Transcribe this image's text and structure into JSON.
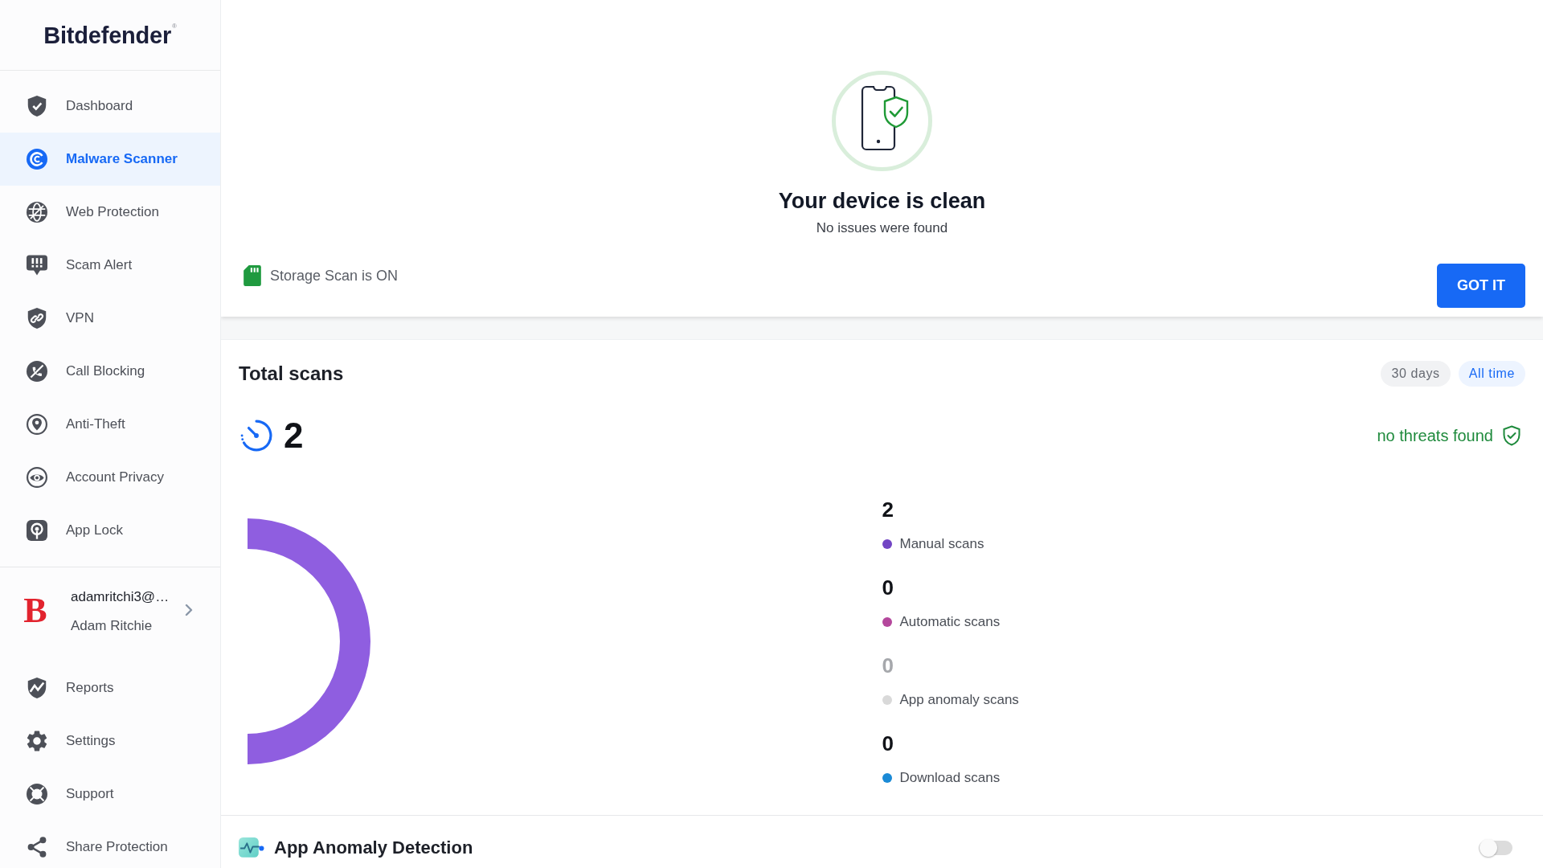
{
  "sidebar": {
    "brand": {
      "name": "Bitdefender",
      "mark": "®"
    },
    "items": [
      {
        "label": "Dashboard",
        "selected": false
      },
      {
        "label": "Malware Scanner",
        "selected": true
      },
      {
        "label": "Web Protection",
        "selected": false
      },
      {
        "label": "Scam Alert",
        "selected": false
      },
      {
        "label": "VPN",
        "selected": false
      },
      {
        "label": "Call Blocking",
        "selected": false
      },
      {
        "label": "Anti-Theft",
        "selected": false
      },
      {
        "label": "Account Privacy",
        "selected": false
      },
      {
        "label": "App Lock",
        "selected": false
      }
    ],
    "account": {
      "logo_letter": "B",
      "email": "adamritchi3@…",
      "name": "Adam Ritchie"
    },
    "bottom_items": [
      {
        "label": "Reports",
        "selected": false
      },
      {
        "label": "Settings",
        "selected": false
      },
      {
        "label": "Support",
        "selected": false
      },
      {
        "label": "Share Protection",
        "selected": false
      }
    ]
  },
  "scan_result": {
    "title": "Your device is clean",
    "subtitle": "No issues were found",
    "storage_scan": "Storage Scan is ON",
    "button": "GOT IT"
  },
  "total_scans": {
    "title": "Total scans",
    "ranges": [
      {
        "label": "30 days",
        "selected": false
      },
      {
        "label": "All time",
        "selected": true
      }
    ],
    "count": "2",
    "result": "no threats found",
    "legend": [
      {
        "value": "2",
        "label": "Manual scans",
        "color": "#7245c4",
        "disabled": false
      },
      {
        "value": "0",
        "label": "Automatic scans",
        "color": "#b4479c",
        "disabled": false
      },
      {
        "value": "0",
        "label": "App anomaly scans",
        "color": "#d9d9d9",
        "disabled": true
      },
      {
        "value": "0",
        "label": "Download scans",
        "color": "#1a8ad6",
        "disabled": false
      }
    ]
  },
  "app_anomaly": {
    "title": "App Anomaly Detection",
    "on": false
  }
}
